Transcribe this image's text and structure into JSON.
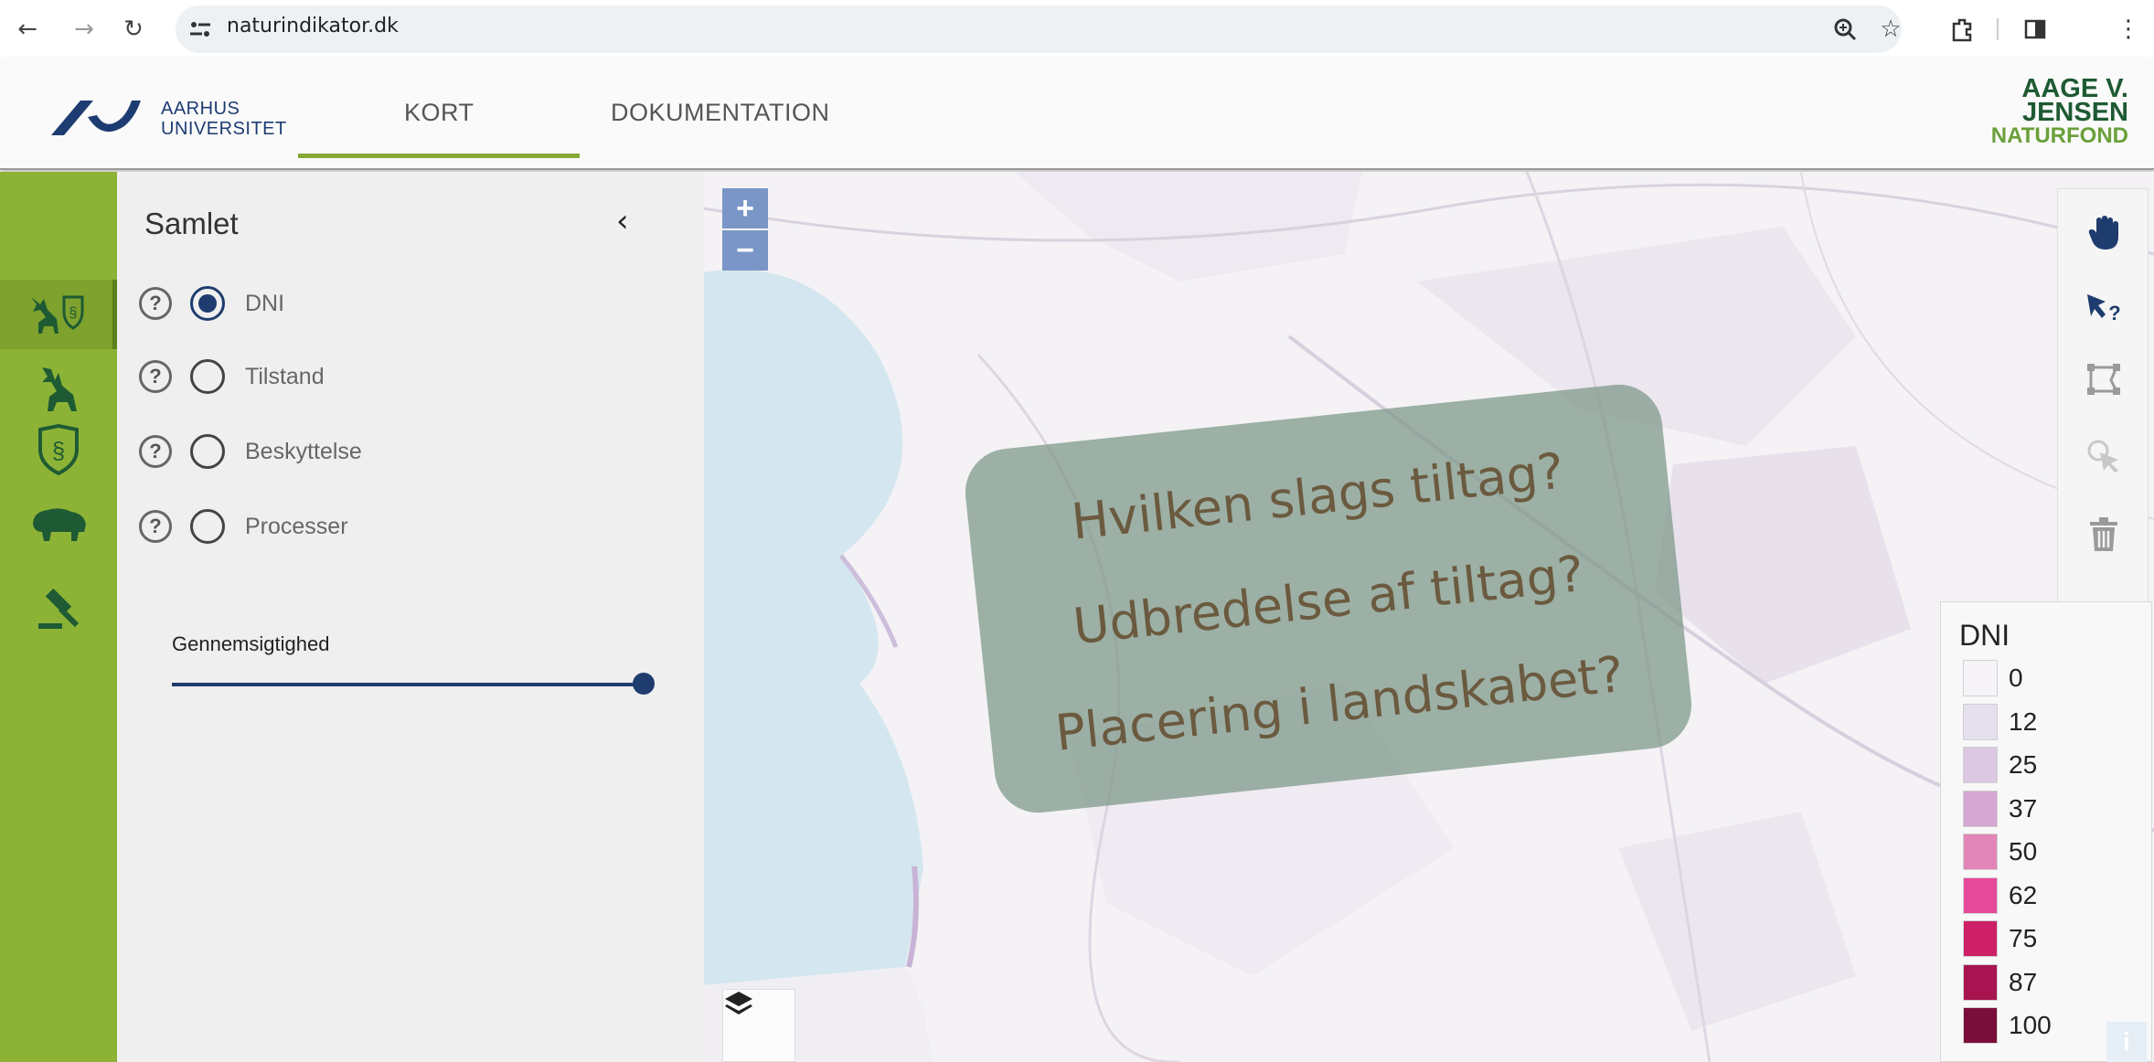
{
  "browser": {
    "url": "naturindikator.dk",
    "back_icon": "←",
    "forward_icon": "→",
    "reload_icon": "↻"
  },
  "header": {
    "org_name_line1": "AARHUS",
    "org_name_line2": "UNIVERSITET",
    "tabs": [
      {
        "label": "KORT",
        "active": true
      },
      {
        "label": "DOKUMENTATION",
        "active": false
      }
    ],
    "partner_logo": {
      "line1": "AAGE V.",
      "line2": "JENSEN",
      "line3": "NATURFOND"
    }
  },
  "rail": {
    "items": [
      {
        "icon": "deer-shield-icon",
        "active": true
      },
      {
        "icon": "deer-icon",
        "active": false
      },
      {
        "icon": "shield-icon",
        "active": false
      },
      {
        "icon": "bison-icon",
        "active": false
      },
      {
        "icon": "gavel-icon",
        "active": false
      }
    ]
  },
  "panel": {
    "title": "Samlet",
    "collapse": "‹",
    "options": [
      {
        "label": "DNI",
        "checked": true
      },
      {
        "label": "Tilstand",
        "checked": false
      },
      {
        "label": "Beskyttelse",
        "checked": false
      },
      {
        "label": "Processer",
        "checked": false
      }
    ],
    "opacity_label": "Gennemsigtighed",
    "opacity_value": 1.0
  },
  "map": {
    "zoom_in": "+",
    "zoom_out": "−"
  },
  "overlay": {
    "lines": [
      "Hvilken slags tiltag?",
      "Udbredelse af tiltag?",
      "Placering i landskabet?"
    ]
  },
  "tools": [
    {
      "icon": "pan-hand-icon",
      "active": true
    },
    {
      "icon": "identify-pointer-icon",
      "active": false
    },
    {
      "icon": "draw-polygon-icon",
      "active": false
    },
    {
      "icon": "select-icon",
      "active": false
    },
    {
      "icon": "trash-icon",
      "active": false
    }
  ],
  "legend": {
    "title": "DNI",
    "entries": [
      {
        "value": "0",
        "color": "#f6f4f8"
      },
      {
        "value": "12",
        "color": "#e6e0ee"
      },
      {
        "value": "25",
        "color": "#dcc8e2"
      },
      {
        "value": "37",
        "color": "#d4a8d2"
      },
      {
        "value": "50",
        "color": "#e286b8"
      },
      {
        "value": "62",
        "color": "#e6499a"
      },
      {
        "value": "75",
        "color": "#cd2066"
      },
      {
        "value": "87",
        "color": "#a81450"
      },
      {
        "value": "100",
        "color": "#7a0e3a"
      }
    ]
  },
  "colors": {
    "accent_green": "#8cb336",
    "brand_blue": "#1e3c6e",
    "water": "#d4e6ef"
  }
}
